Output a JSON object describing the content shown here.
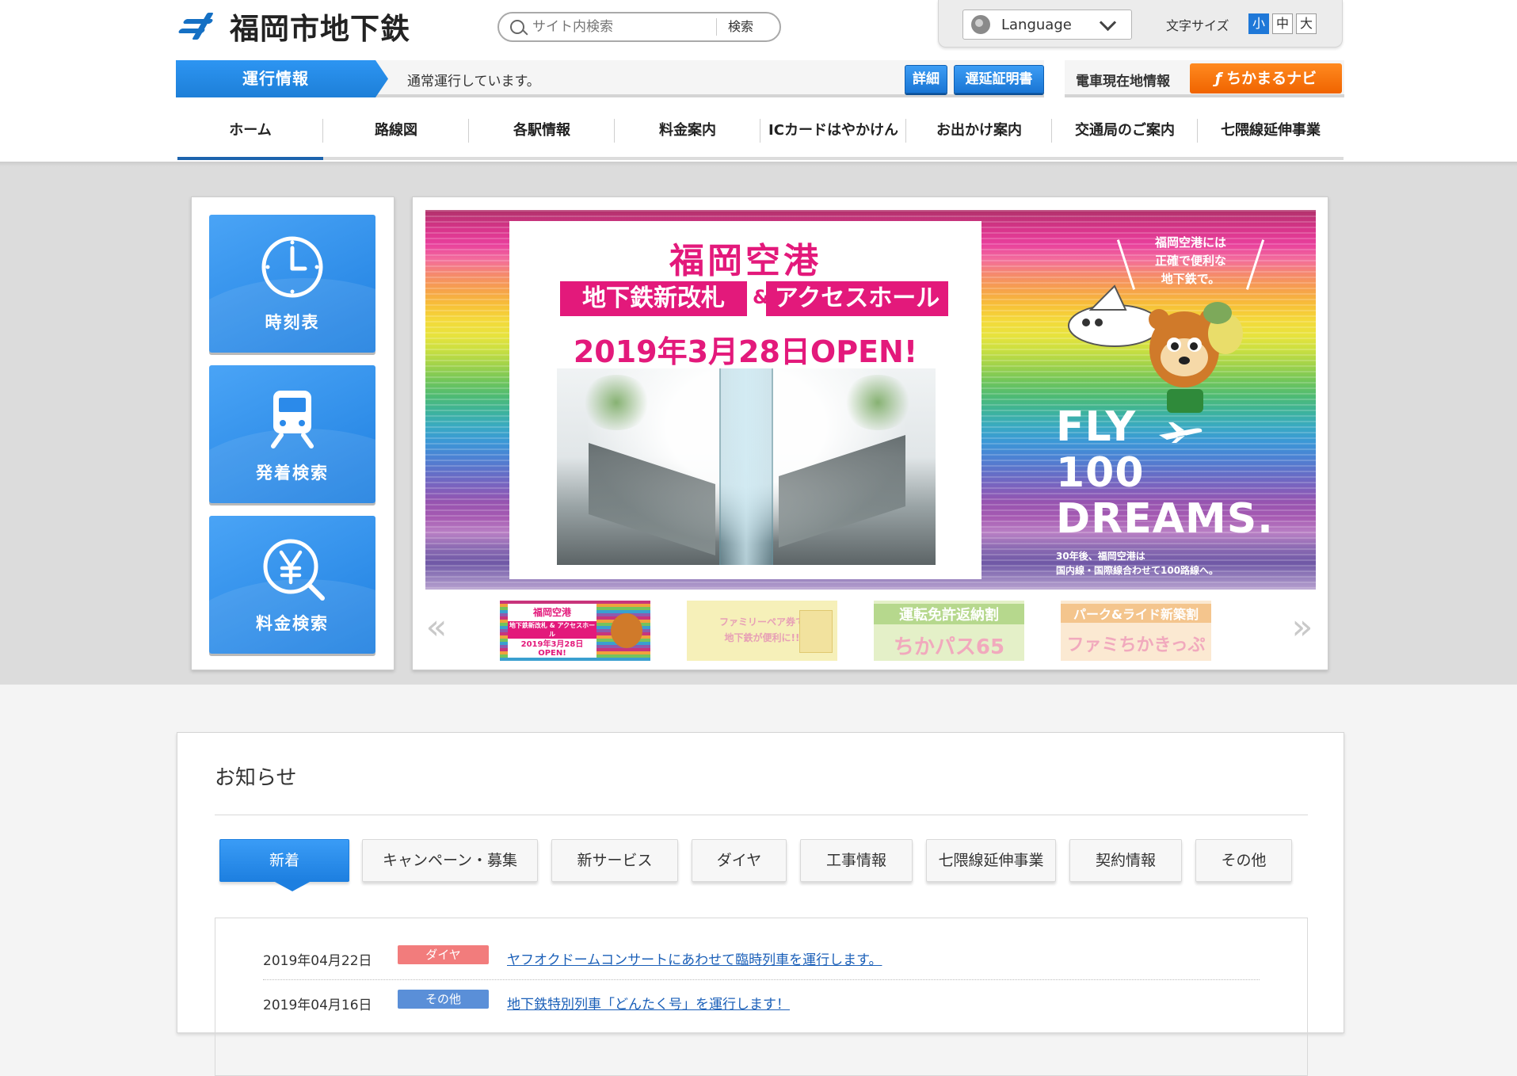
{
  "site": {
    "logo_text": "福岡市地下鉄"
  },
  "search": {
    "placeholder": "サイト内検索",
    "button_label": "検索"
  },
  "tools": {
    "language_label": "Language",
    "font_size_label": "文字サイズ",
    "font_sizes": [
      "小",
      "中",
      "大"
    ],
    "font_size_selected": "小"
  },
  "operation": {
    "tag": "運行情報",
    "status": "通常運行しています。",
    "detail_button": "詳細",
    "delay_cert_button": "遅延証明書"
  },
  "train_navi": {
    "label": "電車現在地情報",
    "button": "ちかまるナビ"
  },
  "nav": {
    "items": [
      "ホーム",
      "路線図",
      "各駅情報",
      "料金案内",
      "ICカードはやかけん",
      "お出かけ案内",
      "交通局のご案内",
      "七隈線延伸事業"
    ],
    "active": "ホーム"
  },
  "quick_links": [
    "時刻表",
    "発着検索",
    "料金検索"
  ],
  "banner": {
    "title": "福岡空港",
    "sub1": "地下鉄新改札",
    "amp": "&",
    "sub2": "アクセスホール",
    "date": "2019年3月28日OPEN!",
    "copy": "福岡空港には\n正確で便利な\n地下鉄で。",
    "fly_lines": [
      "FLY",
      "100",
      "DREAMS."
    ],
    "foot": "30年後、福岡空港は\n国内線・国際線合わせて100路線へ。"
  },
  "thumbnails": [
    {
      "line1": "福岡空港",
      "line2": "地下鉄新改札 & アクセスホール",
      "line3": "2019年3月28日OPEN!"
    },
    {
      "line1": "ファミリーペア券で",
      "line2": "地下鉄が便利に!!"
    },
    {
      "line1": "運転免許返納割",
      "line2": "ちかパス65"
    },
    {
      "line1": "パーク&ライド新築割",
      "line2": "ファミちかきっぷ"
    }
  ],
  "news": {
    "heading": "お知らせ",
    "tabs": [
      "新着",
      "キャンペーン・募集",
      "新サービス",
      "ダイヤ",
      "工事情報",
      "七隈線延伸事業",
      "契約情報",
      "その他"
    ],
    "active_tab": "新着",
    "items": [
      {
        "date": "2019年04月22日",
        "category": "ダイヤ",
        "title": "ヤフオクドームコンサートにあわせて臨時列車を運行します。"
      },
      {
        "date": "2019年04月16日",
        "category": "その他",
        "title": "地下鉄特別列車「どんたく号」を運行します！"
      }
    ]
  },
  "colors": {
    "primary_blue": "#1f7fe0",
    "nav_active": "#1c63ad",
    "navi_orange": "#f47a12",
    "badge_diya": "#f27c7c",
    "badge_other": "#5a8fd8",
    "banner_magenta": "#e3197b"
  }
}
